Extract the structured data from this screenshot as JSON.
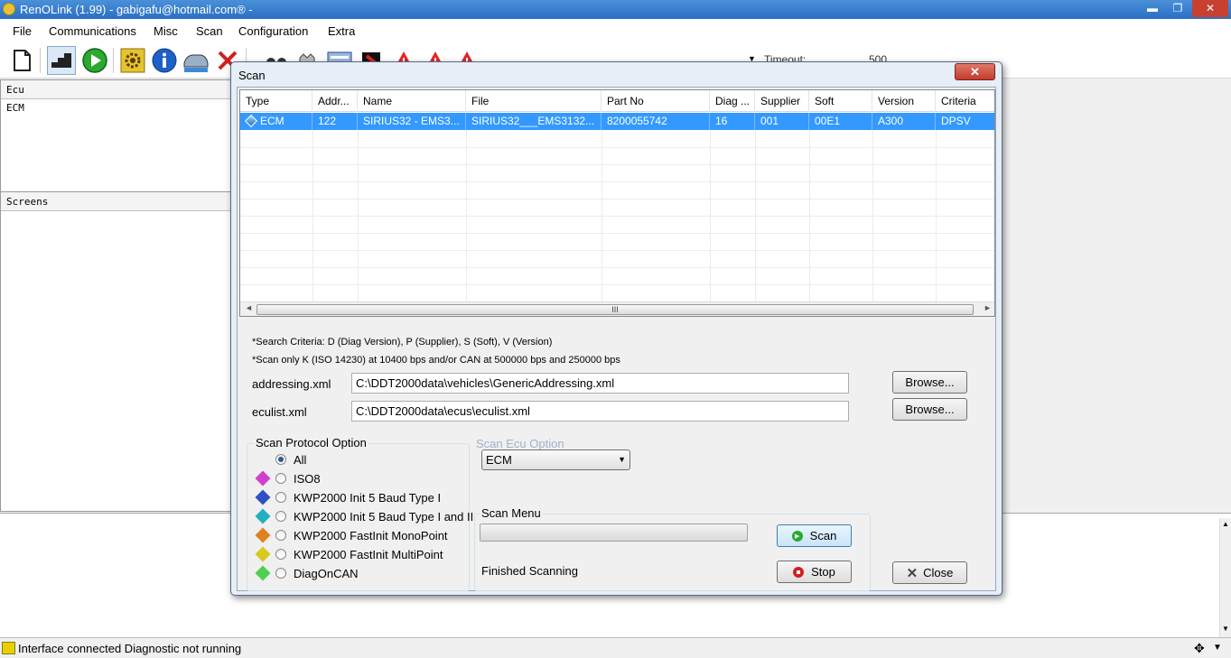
{
  "app": {
    "title": "RenOLink (1.99) - gabigafu@hotmail.com® -"
  },
  "window_controls": {
    "minimize": "▬",
    "maximize": "❐",
    "close": "✕"
  },
  "menu": [
    "File",
    "Communications",
    "Misc",
    "Scan",
    "Configuration",
    "Extra"
  ],
  "toolbar": {
    "timeout_label": "Timeout:",
    "timeout_value": "500"
  },
  "left": {
    "ecu_header": "Ecu",
    "ecu_item": "ECM",
    "screens_header": "Screens"
  },
  "status": {
    "text": "Interface connected Diagnostic not running"
  },
  "dialog": {
    "title": "Scan",
    "close_label": "✕",
    "columns": [
      "Type",
      "Addr...",
      "Name",
      "File",
      "Part No",
      "Diag ...",
      "Supplier",
      "Soft",
      "Version",
      "Criteria"
    ],
    "row": [
      "ECM",
      "122",
      "SIRIUS32 - EMS3...",
      "SIRIUS32___EMS3132...",
      "8200055742",
      "16",
      "001",
      "00E1",
      "A300",
      "DPSV"
    ],
    "scroll_grip": "III",
    "info1": "*Search Criteria: D (Diag Version), P (Supplier), S (Soft), V (Version)",
    "info2": "*Scan only K (ISO 14230) at 10400 bps and/or CAN at 500000 bps and 250000 bps",
    "addressing_label": "addressing.xml",
    "addressing_value": "C:\\DDT2000data\\vehicles\\GenericAddressing.xml",
    "eculist_label": "eculist.xml",
    "eculist_value": "C:\\DDT2000data\\ecus\\eculist.xml",
    "browse_label": "Browse...",
    "protocol_title": "Scan Protocol Option",
    "protocols": [
      {
        "label": "All",
        "selected": true,
        "color": ""
      },
      {
        "label": "ISO8",
        "selected": false,
        "color": "#d040d0"
      },
      {
        "label": "KWP2000 Init 5 Baud Type I",
        "selected": false,
        "color": "#3050c8"
      },
      {
        "label": "KWP2000 Init 5 Baud Type I and II",
        "selected": false,
        "color": "#20b0c0"
      },
      {
        "label": "KWP2000 FastInit MonoPoint",
        "selected": false,
        "color": "#e08020"
      },
      {
        "label": "KWP2000 FastInit MultiPoint",
        "selected": false,
        "color": "#d8c820"
      },
      {
        "label": "DiagOnCAN",
        "selected": false,
        "color": "#50d050"
      }
    ],
    "ecu_option_title": "Scan Ecu Option",
    "ecu_option_value": "ECM",
    "scan_menu_title": "Scan Menu",
    "scan_button": "Scan",
    "stop_button": "Stop",
    "close_button": "Close",
    "scan_status": "Finished Scanning",
    "progress": 0
  }
}
